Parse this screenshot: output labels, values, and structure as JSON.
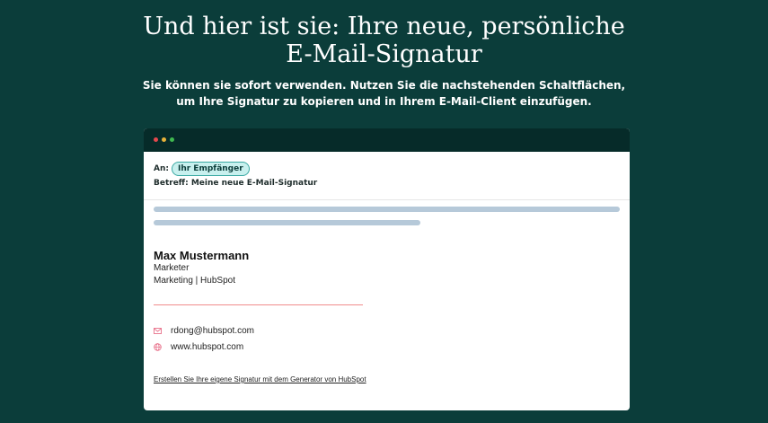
{
  "headline": "Und hier ist sie: Ihre neue, persönliche E-Mail-Signatur",
  "subline": "Sie können sie sofort verwenden. Nutzen Sie die nachstehenden Schaltflächen, um Ihre Signatur zu kopieren und in Ihrem E-Mail-Client einzufügen.",
  "email_preview": {
    "to_label": "An:",
    "recipient_chip": "Ihr Empfänger",
    "subject": "Betreff: Meine neue E-Mail-Signatur",
    "window_dots": [
      "#e5484d",
      "#e8b23a",
      "#3fb950"
    ]
  },
  "signature": {
    "name": "Max Mustermann",
    "role": "Marketer",
    "company": "Marketing | HubSpot",
    "divider_color": "#f08c8c",
    "email": "rdong@hubspot.com",
    "email_icon": "mail-icon",
    "website": "www.hubspot.com",
    "website_icon": "globe-icon",
    "icon_color": "#e8708a"
  },
  "footer_link": "Erstellen Sie Ihre eigene Signatur mit dem Generator von HubSpot",
  "colors": {
    "background": "#0b3d3a",
    "titlebar": "#062b29",
    "chip_bg": "#c8f0ee",
    "placeholder_bar": "#b6c9d9"
  }
}
